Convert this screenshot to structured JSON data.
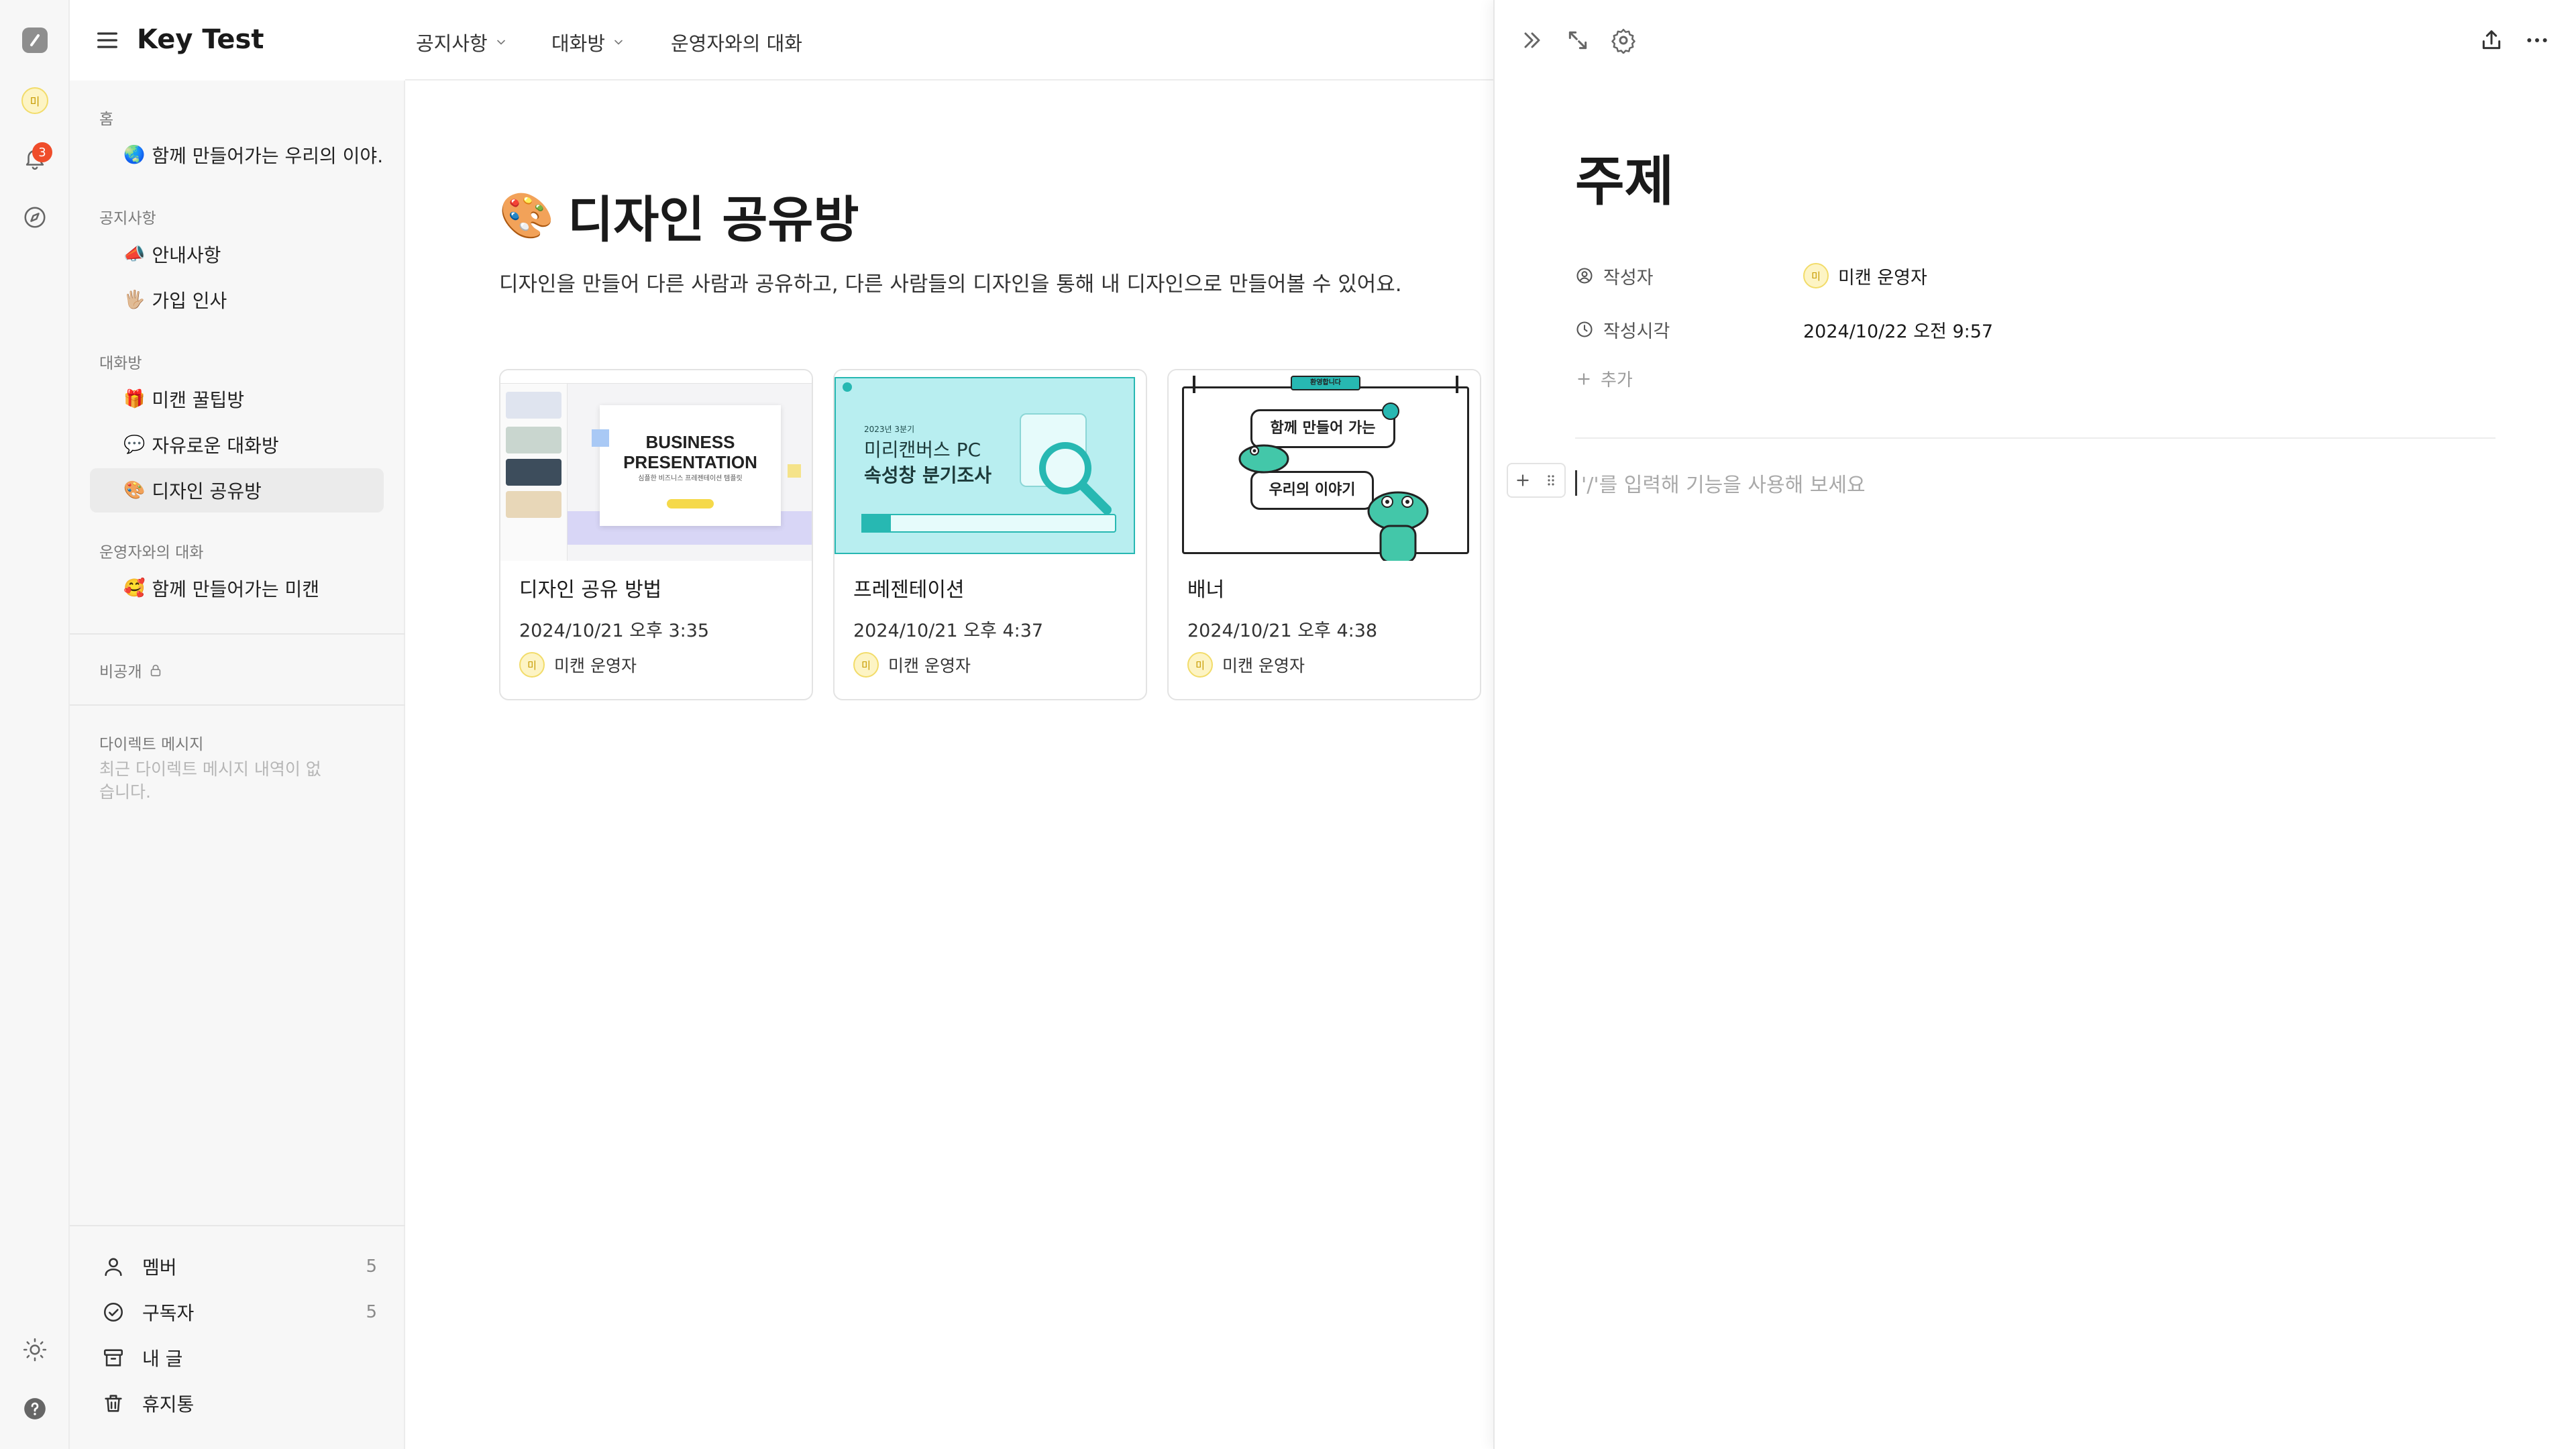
{
  "rail": {
    "avatar_initial": "미",
    "notification_count": "3"
  },
  "topbar": {
    "workspace_title": "Key Test",
    "nav": [
      {
        "label": "공지사항"
      },
      {
        "label": "대화방"
      },
      {
        "label": "운영자와의 대화"
      }
    ]
  },
  "sidebar": {
    "sections": [
      {
        "label": "홈",
        "items": [
          {
            "emoji": "🌏",
            "label": "함께 만들어가는 우리의 이야..."
          }
        ]
      },
      {
        "label": "공지사항",
        "items": [
          {
            "emoji": "📣",
            "label": "안내사항"
          },
          {
            "emoji": "🖐🏼",
            "label": "가입 인사"
          }
        ]
      },
      {
        "label": "대화방",
        "items": [
          {
            "emoji": "🎁",
            "label": "미캔 꿀팁방"
          },
          {
            "emoji": "💬",
            "label": "자유로운 대화방"
          },
          {
            "emoji": "🎨",
            "label": "디자인 공유방"
          }
        ]
      },
      {
        "label": "운영자와의 대화",
        "items": [
          {
            "emoji": "🥰",
            "label": "함께 만들어가는 미캔"
          }
        ]
      }
    ],
    "private_label": "비공개",
    "dm_label": "다이렉트 메시지",
    "dm_empty": "최근 다이렉트 메시지 내역이 없습니다.",
    "bottom": [
      {
        "label": "멤버",
        "count": "5"
      },
      {
        "label": "구독자",
        "count": "5"
      },
      {
        "label": "내 글",
        "count": ""
      },
      {
        "label": "휴지통",
        "count": ""
      }
    ]
  },
  "main": {
    "title_emoji": "🎨",
    "title": "디자인 공유방",
    "description": "디자인을 만들어 다른 사람과 공유하고, 다른 사람들의 디자인을 통해 내 디자인으로 만들어볼 수 있어요.",
    "cards": [
      {
        "title": "디자인 공유 방법",
        "date": "2024/10/21 오후 3:35",
        "author": "미캔 운영자",
        "author_initial": "미",
        "thumb_text_1": "BUSINESS",
        "thumb_text_2": "PRESENTATION",
        "thumb_text_3": "심플한 비즈니스 프레젠테이션 템플릿"
      },
      {
        "title": "프레젠테이션",
        "date": "2024/10/21 오후 4:37",
        "author": "미캔 운영자",
        "author_initial": "미",
        "thumb_text_1": "2023년 3분기",
        "thumb_text_2": "미리캔버스 PC",
        "thumb_text_3": "속성창 분기조사"
      },
      {
        "title": "배너",
        "date": "2024/10/21 오후 4:38",
        "author": "미캔 운영자",
        "author_initial": "미",
        "thumb_text_1": "함께 만들어 가는",
        "thumb_text_2": "우리의 이야기",
        "thumb_text_3": "환영합니다"
      }
    ]
  },
  "panel": {
    "title": "주제",
    "props": [
      {
        "label": "작성자",
        "value": "미캔 운영자",
        "value_initial": "미"
      },
      {
        "label": "작성시각",
        "value": "2024/10/22 오전 9:57"
      }
    ],
    "add_label": "추가",
    "editor_placeholder": "'/'를 입력해 기능을 사용해 보세요"
  },
  "colors": {
    "sidebar_bg": "#f7f7f7",
    "badge": "#ef4d2b",
    "avatar_bg": "#fdf4c4",
    "thumb_mint": "#b8eef0",
    "thumb_teal": "#27b8b2"
  }
}
